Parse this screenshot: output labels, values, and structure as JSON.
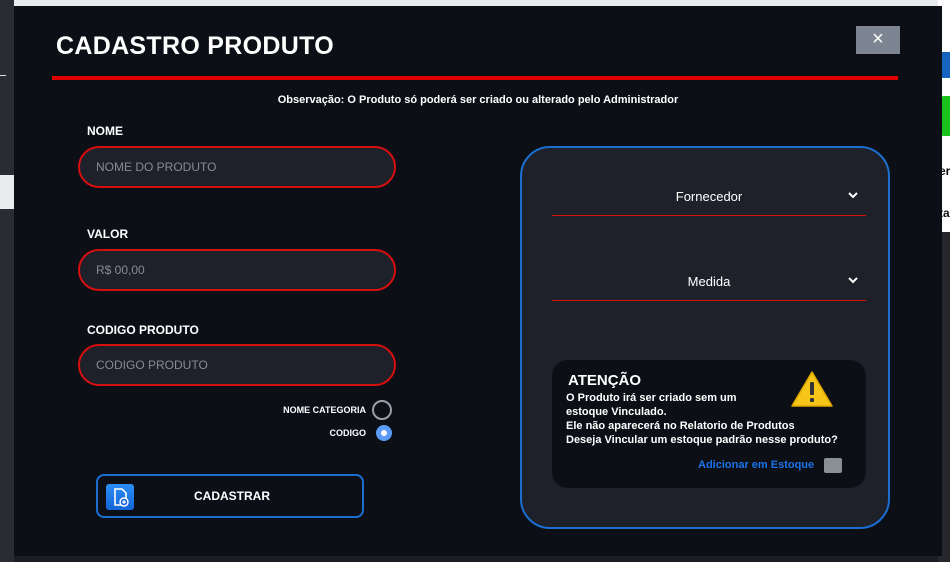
{
  "modal": {
    "title": "CADASTRO PRODUTO",
    "close_symbol": "×",
    "note": "Observação: O Produto só poderá ser criado ou alterado pelo Administrador"
  },
  "form": {
    "nome": {
      "label": "NOME",
      "placeholder": "NOME DO PRODUTO",
      "value": ""
    },
    "valor": {
      "label": "VALOR",
      "placeholder": "R$ 00,00",
      "value": ""
    },
    "codigo": {
      "label": "CODIGO PRODUTO",
      "placeholder": "CODIGO PRODUTO",
      "value": ""
    },
    "radio_options": [
      {
        "label": "NOME CATEGORIA",
        "checked": false
      },
      {
        "label": "CODIGO",
        "checked": true
      }
    ],
    "submit_label": "CADASTRAR",
    "submit_icon": "document-add-icon"
  },
  "panel": {
    "fornecedor_select": "Fornecedor",
    "medida_select": "Medida",
    "alert": {
      "title": "ATENÇÃO",
      "lines": [
        "O Produto irá ser criado sem um",
        "estoque Vinculado.",
        "Ele não aparecerá no Relatorio de Produtos",
        "Deseja Vincular um estoque padrão nesse produto?"
      ],
      "icon": "warning-icon",
      "link_label": "Adicionar em Estoque",
      "checkbox_checked": false
    }
  },
  "background": {
    "right_text_1": "er",
    "right_text_2": "ta"
  },
  "colors": {
    "modal_bg": "#0c0f16",
    "accent_red": "#e00000",
    "accent_blue": "#1a6fd1",
    "field_bg": "#1e2129",
    "warning": "#f5c518"
  }
}
